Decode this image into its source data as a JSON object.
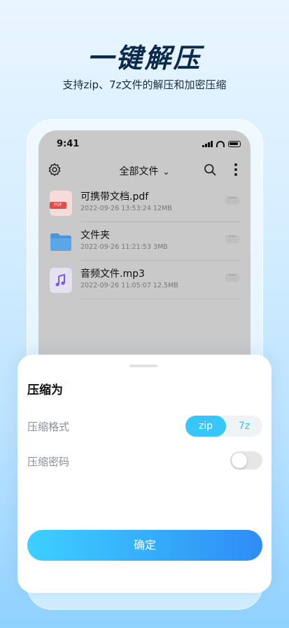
{
  "hero": {
    "title": "一键解压",
    "subtitle": "支持zip、7z文件的解压和加密压缩"
  },
  "status_bar": {
    "time": "9:41"
  },
  "toolbar": {
    "folder_selector": "全部文件"
  },
  "files": [
    {
      "name": "可携带文档.pdf",
      "meta": "2022-09-26 13:53:24 12MB",
      "icon": "pdf-file-icon",
      "icon_tag": "PDF"
    },
    {
      "name": "文件夹",
      "meta": "2022-09-26 11:21:53 3MB",
      "icon": "folder-icon"
    },
    {
      "name": "音频文件.mp3",
      "meta": "2022-09-26 11:05:07 12.5MB",
      "icon": "music-file-icon"
    }
  ],
  "sheet": {
    "title": "压缩为",
    "format_label": "压缩格式",
    "format_options": [
      "zip",
      "7z"
    ],
    "format_selected": "zip",
    "password_label": "压缩密码",
    "password_enabled": false,
    "confirm_label": "确定"
  },
  "colors": {
    "accent": "#38c6ff",
    "button_start": "#3dd0ff",
    "button_end": "#2f8cf5",
    "title": "#0c2a4a"
  }
}
